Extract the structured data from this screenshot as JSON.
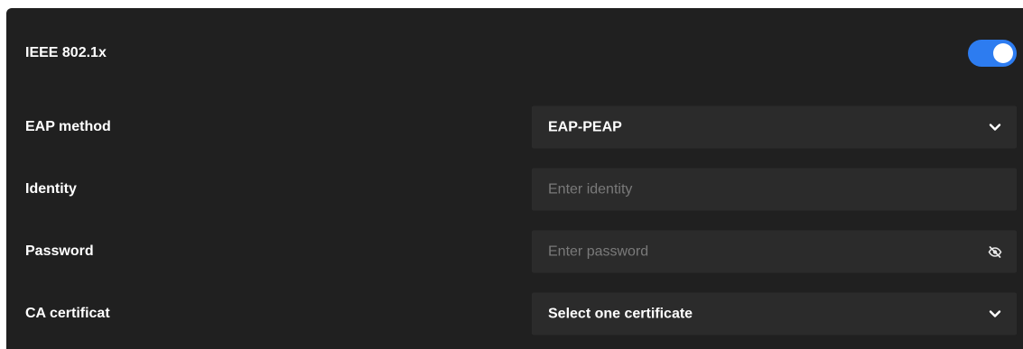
{
  "section": {
    "title": "IEEE 802.1x",
    "toggle_on": true,
    "accent_color": "#2d7cf0"
  },
  "fields": {
    "eap_method": {
      "label": "EAP method",
      "value": "EAP-PEAP",
      "icon": "chevron-down-icon"
    },
    "identity": {
      "label": "Identity",
      "value": "",
      "placeholder": "Enter identity"
    },
    "password": {
      "label": "Password",
      "value": "",
      "placeholder": "Enter password",
      "icon": "eye-off-icon"
    },
    "ca_certificate": {
      "label": "CA certificat",
      "value": "Select one certificate",
      "icon": "chevron-down-icon"
    }
  }
}
